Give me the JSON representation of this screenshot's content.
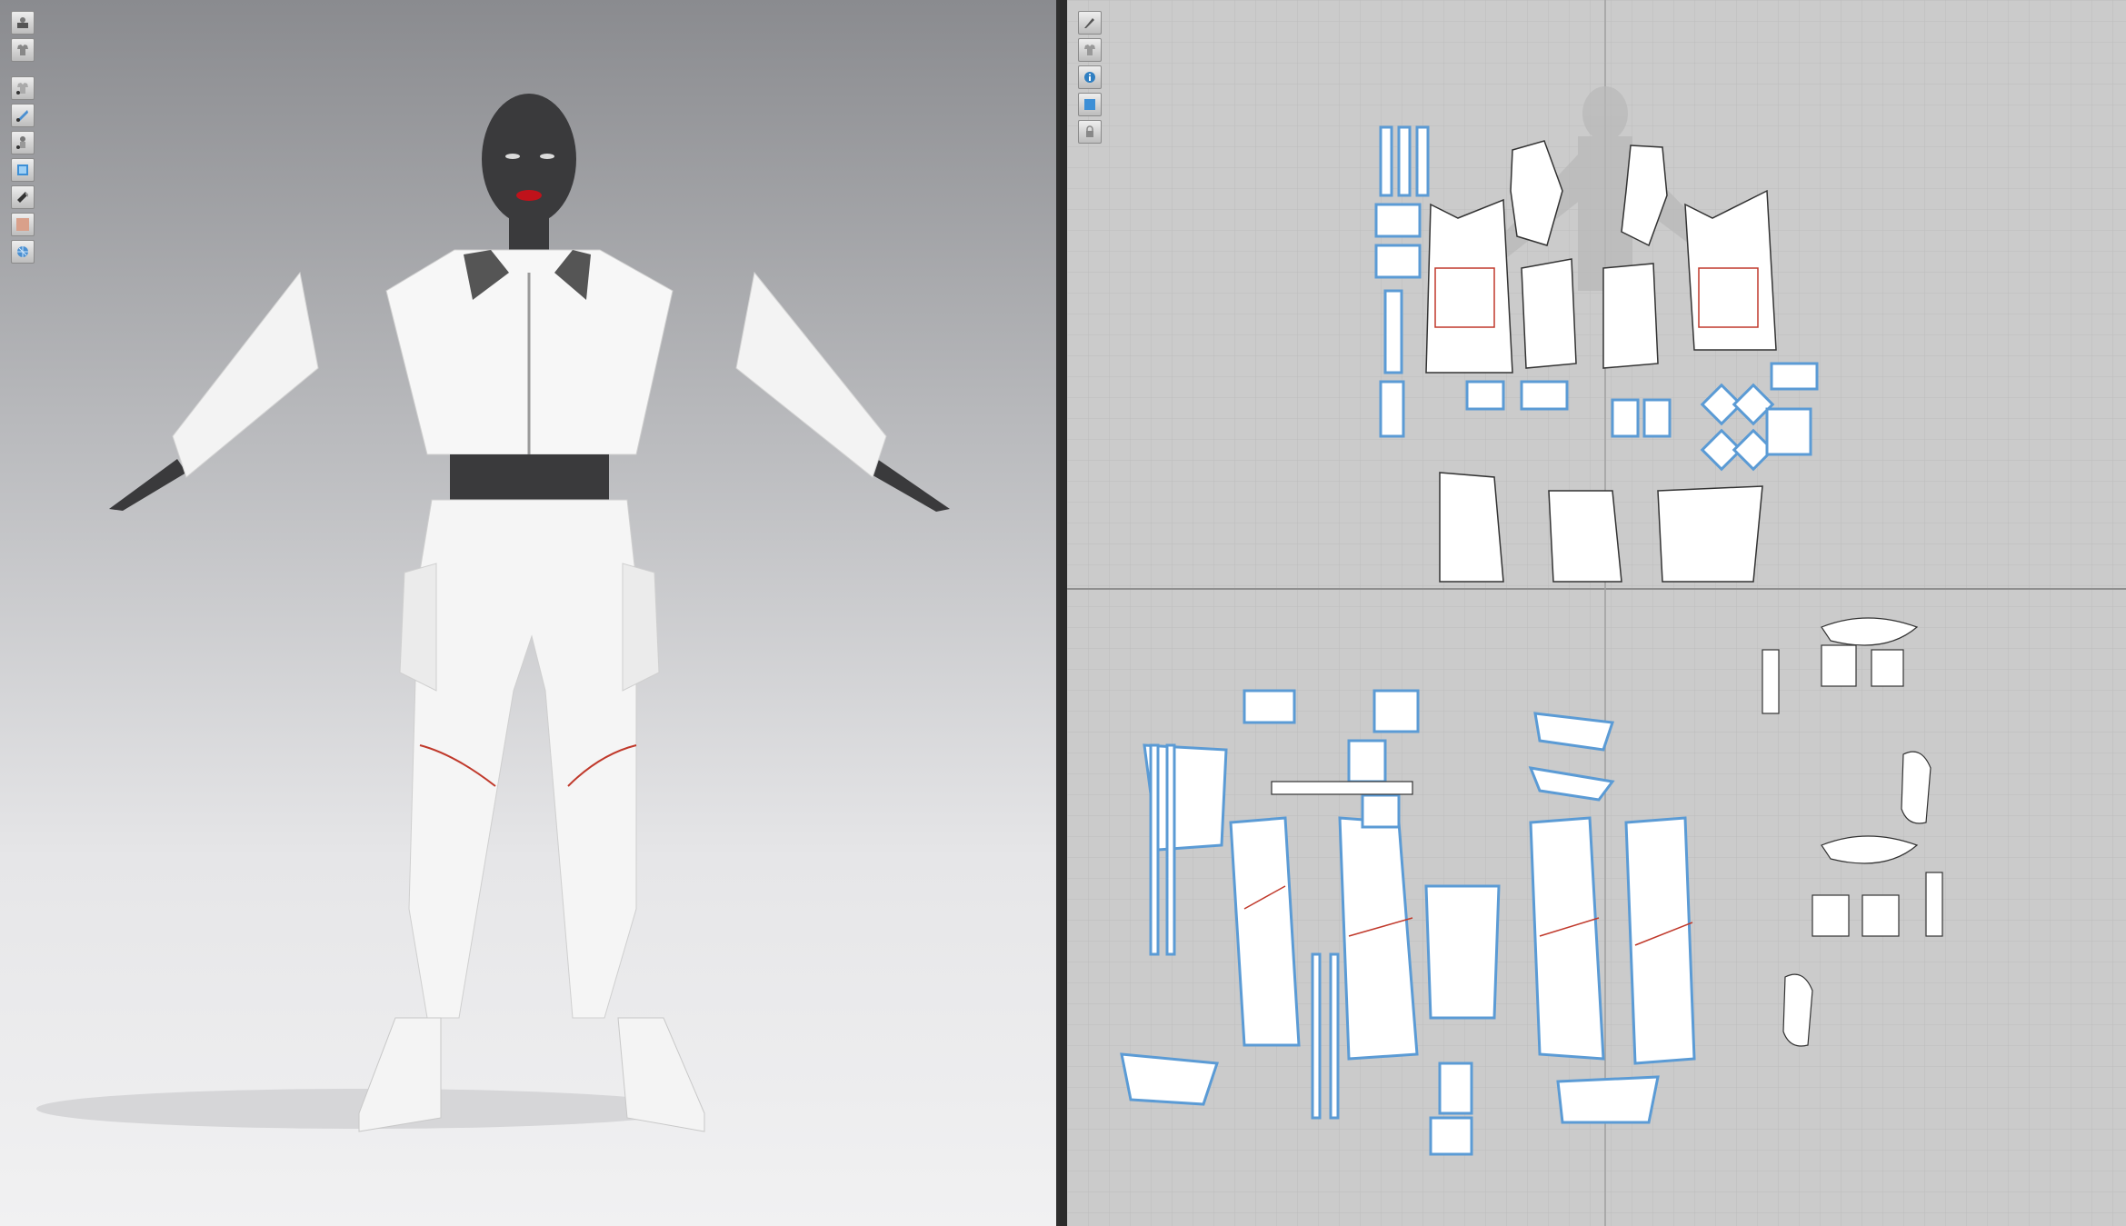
{
  "viewport_3d": {
    "toolbar": [
      {
        "icon": "avatar-display-icon"
      },
      {
        "icon": "garment-display-icon"
      },
      {
        "icon": "shading-mode-icon"
      },
      {
        "icon": "texture-display-icon"
      },
      {
        "icon": "avatar-visibility-icon"
      },
      {
        "icon": "fabric-render-icon"
      },
      {
        "icon": "thickness-icon"
      },
      {
        "icon": "skin-display-icon"
      },
      {
        "icon": "mesh-display-icon"
      }
    ]
  },
  "viewport_2d": {
    "toolbar": [
      {
        "icon": "pattern-brush-icon"
      },
      {
        "icon": "garment-view-icon"
      },
      {
        "icon": "pattern-info-icon"
      },
      {
        "icon": "texture-view-icon"
      },
      {
        "icon": "lock-pattern-icon"
      }
    ]
  },
  "colors": {
    "viewport_top": "#8a8b8f",
    "viewport_bottom": "#f1f1f2",
    "pattern_bg": "#cbcbcb",
    "grid_line": "#b9b9b9",
    "pattern_fill": "#ffffff",
    "pattern_selected_outline": "#5b9bd5",
    "pattern_outline": "#333333",
    "seam_red": "#c0392b",
    "avatar_skin": "#3a3a3c",
    "lips": "#c0121b"
  }
}
